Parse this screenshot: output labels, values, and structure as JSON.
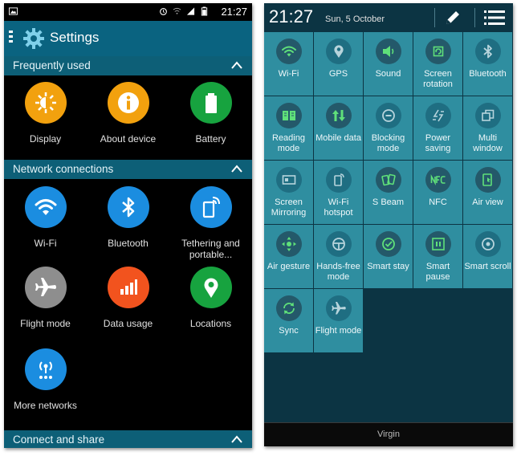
{
  "left": {
    "status_time": "21:27",
    "title": "Settings",
    "sections": [
      {
        "label": "Frequently used",
        "items": [
          {
            "label": "Display",
            "icon": "display-icon",
            "color": "#f2a10e"
          },
          {
            "label": "About device",
            "icon": "info-icon",
            "color": "#f2a10e"
          },
          {
            "label": "Battery",
            "icon": "battery-icon",
            "color": "#17a33f"
          }
        ]
      },
      {
        "label": "Network connections",
        "items": [
          {
            "label": "Wi-Fi",
            "icon": "wifi-icon",
            "color": "#1b8de0"
          },
          {
            "label": "Bluetooth",
            "icon": "bluetooth-icon",
            "color": "#1b8de0"
          },
          {
            "label": "Tethering and portable...",
            "icon": "tethering-icon",
            "color": "#1b8de0"
          },
          {
            "label": "Flight mode",
            "icon": "airplane-icon",
            "color": "#8e8e8e"
          },
          {
            "label": "Data usage",
            "icon": "data-usage-icon",
            "color": "#f2531e"
          },
          {
            "label": "Locations",
            "icon": "location-icon",
            "color": "#17a33f"
          },
          {
            "label": "More networks",
            "icon": "more-networks-icon",
            "color": "#1b8de0"
          }
        ]
      },
      {
        "label": "Connect and share",
        "items": []
      }
    ]
  },
  "right": {
    "time": "21:27",
    "date": "Sun, 5 October",
    "tiles": [
      {
        "label": "Wi-Fi",
        "icon": "wifi-icon",
        "active": true
      },
      {
        "label": "GPS",
        "icon": "location-icon",
        "active": false
      },
      {
        "label": "Sound",
        "icon": "speaker-icon",
        "active": true
      },
      {
        "label": "Screen rotation",
        "icon": "rotation-icon",
        "active": true
      },
      {
        "label": "Bluetooth",
        "icon": "bluetooth-icon",
        "active": false
      },
      {
        "label": "Reading mode",
        "icon": "book-icon",
        "active": true
      },
      {
        "label": "Mobile data",
        "icon": "mobile-data-icon",
        "active": true
      },
      {
        "label": "Blocking mode",
        "icon": "blocking-icon",
        "active": false
      },
      {
        "label": "Power saving",
        "icon": "power-saving-icon",
        "active": false
      },
      {
        "label": "Multi window",
        "icon": "multi-window-icon",
        "active": false
      },
      {
        "label": "Screen Mirroring",
        "icon": "mirroring-icon",
        "active": false
      },
      {
        "label": "Wi-Fi hotspot",
        "icon": "hotspot-icon",
        "active": false
      },
      {
        "label": "S Beam",
        "icon": "s-beam-icon",
        "active": true
      },
      {
        "label": "NFC",
        "icon": "nfc-icon",
        "active": true
      },
      {
        "label": "Air view",
        "icon": "air-view-icon",
        "active": true
      },
      {
        "label": "Air gesture",
        "icon": "air-gesture-icon",
        "active": true
      },
      {
        "label": "Hands-free mode",
        "icon": "hands-free-icon",
        "active": false
      },
      {
        "label": "Smart stay",
        "icon": "smart-stay-icon",
        "active": true
      },
      {
        "label": "Smart pause",
        "icon": "smart-pause-icon",
        "active": true
      },
      {
        "label": "Smart scroll",
        "icon": "smart-scroll-icon",
        "active": false
      },
      {
        "label": "Sync",
        "icon": "sync-icon",
        "active": true
      },
      {
        "label": "Flight mode",
        "icon": "airplane-icon",
        "active": false
      }
    ],
    "carrier": "Virgin"
  }
}
